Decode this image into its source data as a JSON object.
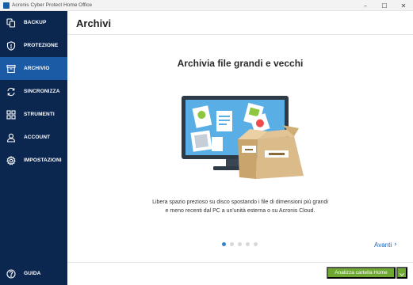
{
  "window": {
    "title": "Acronis Cyber Protect Home Office",
    "controls": {
      "minimize": "–",
      "maximize": "☐",
      "close": "✕"
    }
  },
  "sidebar": {
    "items": [
      {
        "label": "BACKUP",
        "icon": "backup-icon",
        "active": false
      },
      {
        "label": "PROTEZIONE",
        "icon": "shield-icon",
        "active": false
      },
      {
        "label": "ARCHIVIO",
        "icon": "archive-box-icon",
        "active": true
      },
      {
        "label": "SINCRONIZZA",
        "icon": "sync-icon",
        "active": false
      },
      {
        "label": "STRUMENTI",
        "icon": "tools-grid-icon",
        "active": false
      },
      {
        "label": "ACCOUNT",
        "icon": "user-icon",
        "active": false
      },
      {
        "label": "IMPOSTAZIONI",
        "icon": "gear-icon",
        "active": false
      }
    ],
    "help": {
      "label": "GUIDA",
      "icon": "help-icon"
    }
  },
  "header": {
    "title": "Archivi"
  },
  "main": {
    "title": "Archivia file grandi e vecchi",
    "description_line1": "Libera spazio prezioso su disco spostando i file di dimensioni più grandi",
    "description_line2": "e meno recenti dal PC a un'unità esterna o su Acronis Cloud.",
    "pagination": {
      "total": 5,
      "current": 1
    },
    "next_label": "Avanti",
    "next_chevron": "›"
  },
  "footer": {
    "primary_button": "Analizza cartella Home",
    "dropdown_icon": "chevron-down-icon"
  },
  "colors": {
    "sidebar_bg": "#0b2750",
    "sidebar_active": "#1b5aa5",
    "accent_link": "#1a63b8",
    "primary_button": "#6fa831"
  }
}
